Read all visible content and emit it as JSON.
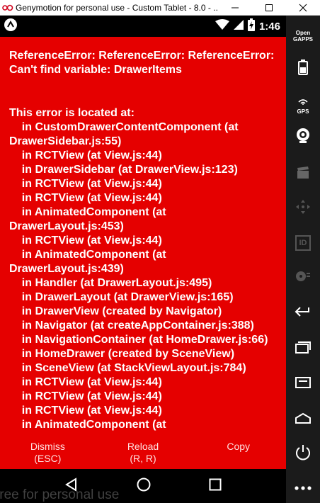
{
  "window": {
    "title": "Genymotion for personal use - Custom Tablet - 8.0 - ...",
    "min_glyph": "—",
    "max_glyph": "☐",
    "close_glyph": "✕"
  },
  "statusbar": {
    "time": "1:46"
  },
  "redbox": {
    "message": "ReferenceError: ReferenceError: ReferenceError: Can't find variable: DrawerItems",
    "stack_header": "This error is located at:",
    "frames": [
      "    in CustomDrawerContentComponent (at",
      "DrawerSidebar.js:55)",
      "    in RCTView (at View.js:44)",
      "    in DrawerSidebar (at DrawerView.js:123)",
      "    in RCTView (at View.js:44)",
      "    in RCTView (at View.js:44)",
      "    in AnimatedComponent (at",
      "DrawerLayout.js:453)",
      "    in RCTView (at View.js:44)",
      "    in AnimatedComponent (at",
      "DrawerLayout.js:439)",
      "    in Handler (at DrawerLayout.js:495)",
      "    in DrawerLayout (at DrawerView.js:165)",
      "    in DrawerView (created by Navigator)",
      "    in Navigator (at createAppContainer.js:388)",
      "    in NavigationContainer (at HomeDrawer.js:66)",
      "    in HomeDrawer (created by SceneView)",
      "    in SceneView (at StackViewLayout.js:784)",
      "    in RCTView (at View.js:44)",
      "    in RCTView (at View.js:44)",
      "    in RCTView (at View.js:44)",
      "    in AnimatedComponent (at"
    ],
    "buttons": {
      "dismiss": {
        "label": "Dismiss",
        "hint": "(ESC)"
      },
      "reload": {
        "label": "Reload",
        "hint": "(R, R)"
      },
      "copy": {
        "label": "Copy",
        "hint": ""
      }
    },
    "background_color": "#e50000"
  },
  "watermark": "free for personal use",
  "sidepanel": {
    "open_gapps_line1": "Open",
    "open_gapps_line2": "GAPPS",
    "gps_label": "GPS",
    "id_label": "ID"
  }
}
